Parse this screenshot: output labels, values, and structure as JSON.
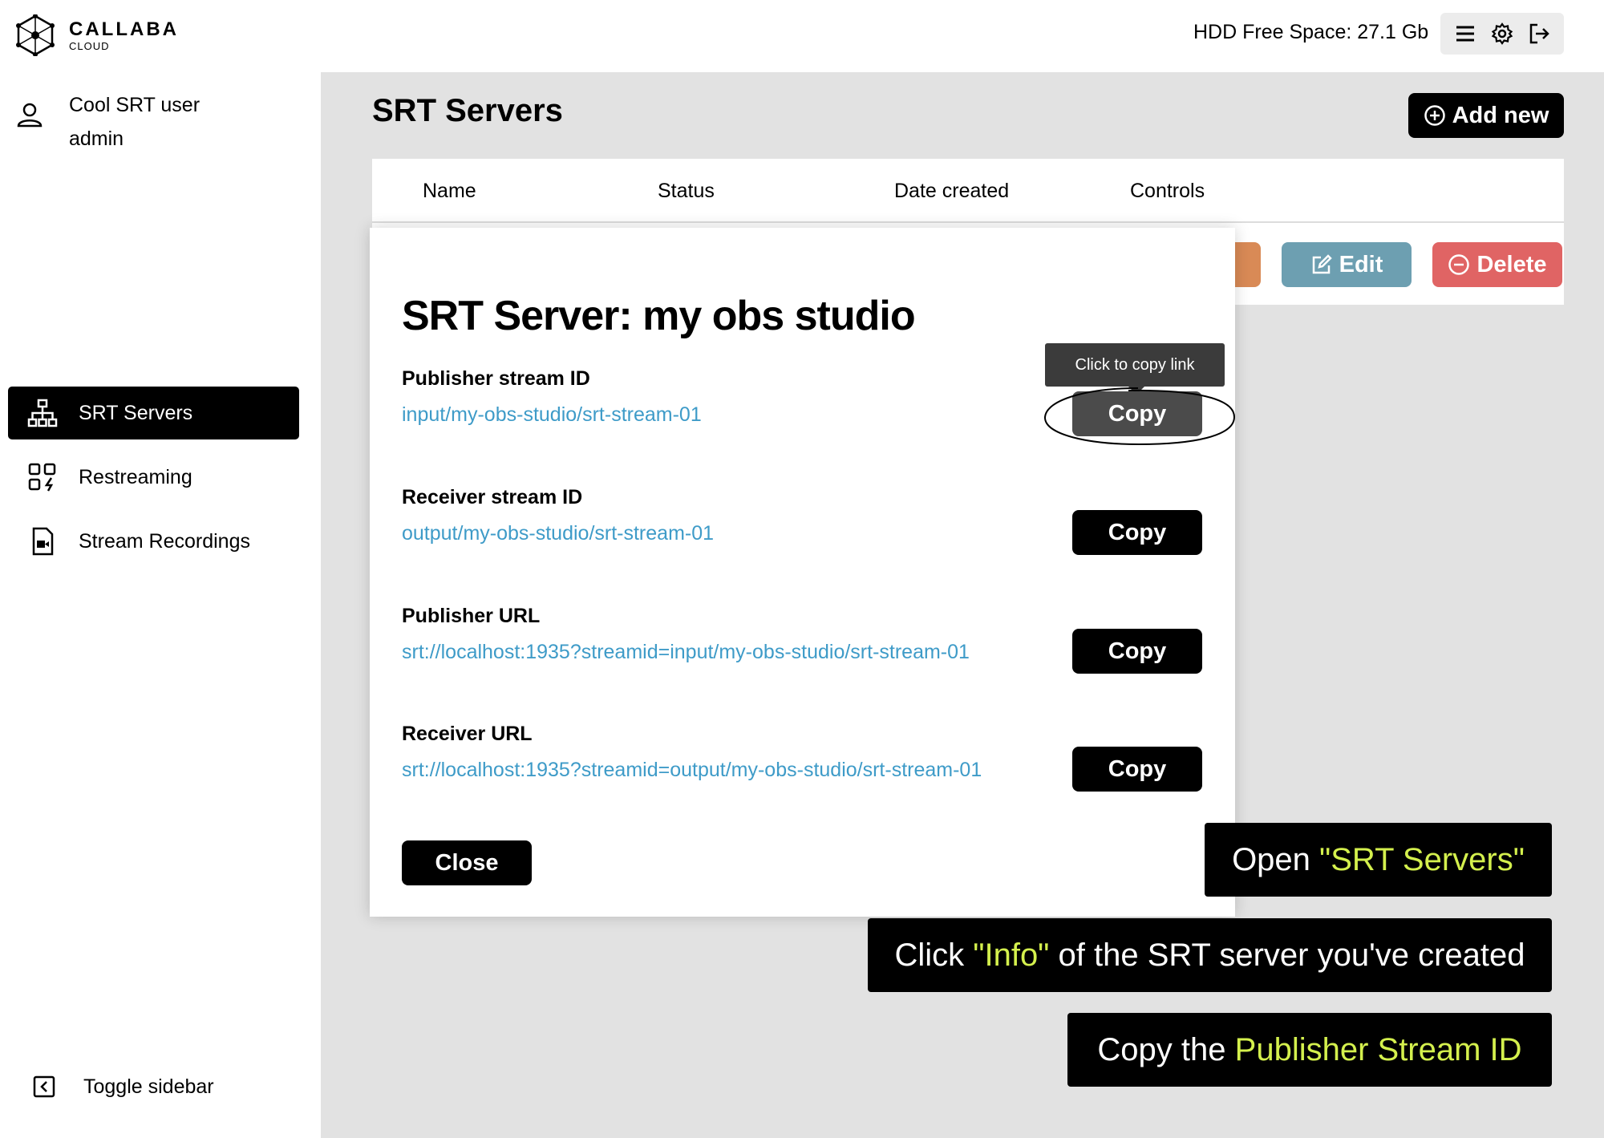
{
  "brand": {
    "name": "CALLABA",
    "sub": "CLOUD"
  },
  "user": {
    "name": "Cool SRT user",
    "role": "admin"
  },
  "nav": [
    {
      "label": "SRT Servers",
      "icon": "sitemap-icon",
      "active": true
    },
    {
      "label": "Restreaming",
      "icon": "restream-icon",
      "active": false
    },
    {
      "label": "Stream Recordings",
      "icon": "video-file-icon",
      "active": false
    }
  ],
  "toggle_sidebar": "Toggle sidebar",
  "topbar": {
    "hdd": "HDD Free Space: 27.1 Gb",
    "icons": [
      "menu-icon",
      "gear-icon",
      "logout-icon"
    ]
  },
  "page": {
    "title": "SRT Servers",
    "add_new": "Add new"
  },
  "table": {
    "columns": [
      "Name",
      "Status",
      "Date created",
      "Controls"
    ],
    "row_controls": {
      "edit": "Edit",
      "delete": "Delete"
    }
  },
  "modal": {
    "title": "SRT Server: my obs studio",
    "tooltip": "Click to copy link",
    "copy_label": "Copy",
    "close_label": "Close",
    "fields": [
      {
        "label": "Publisher stream ID",
        "value": "input/my-obs-studio/srt-stream-01"
      },
      {
        "label": "Receiver stream ID",
        "value": "output/my-obs-studio/srt-stream-01"
      },
      {
        "label": "Publisher URL",
        "value": "srt://localhost:1935?streamid=input/my-obs-studio/srt-stream-01"
      },
      {
        "label": "Receiver URL",
        "value": "srt://localhost:1935?streamid=output/my-obs-studio/srt-stream-01"
      }
    ]
  },
  "callouts": [
    {
      "pre": "Open ",
      "hl": "\"SRT Servers\"",
      "post": ""
    },
    {
      "pre": "Click ",
      "hl": "\"Info\"",
      "post": " of the SRT server you've created"
    },
    {
      "pre": "Copy the ",
      "hl": "Publisher Stream ID",
      "post": ""
    }
  ],
  "colors": {
    "link": "#3e9bc8",
    "highlight": "#d4f04d",
    "edit": "#6d9fb1",
    "delete": "#e06464"
  }
}
